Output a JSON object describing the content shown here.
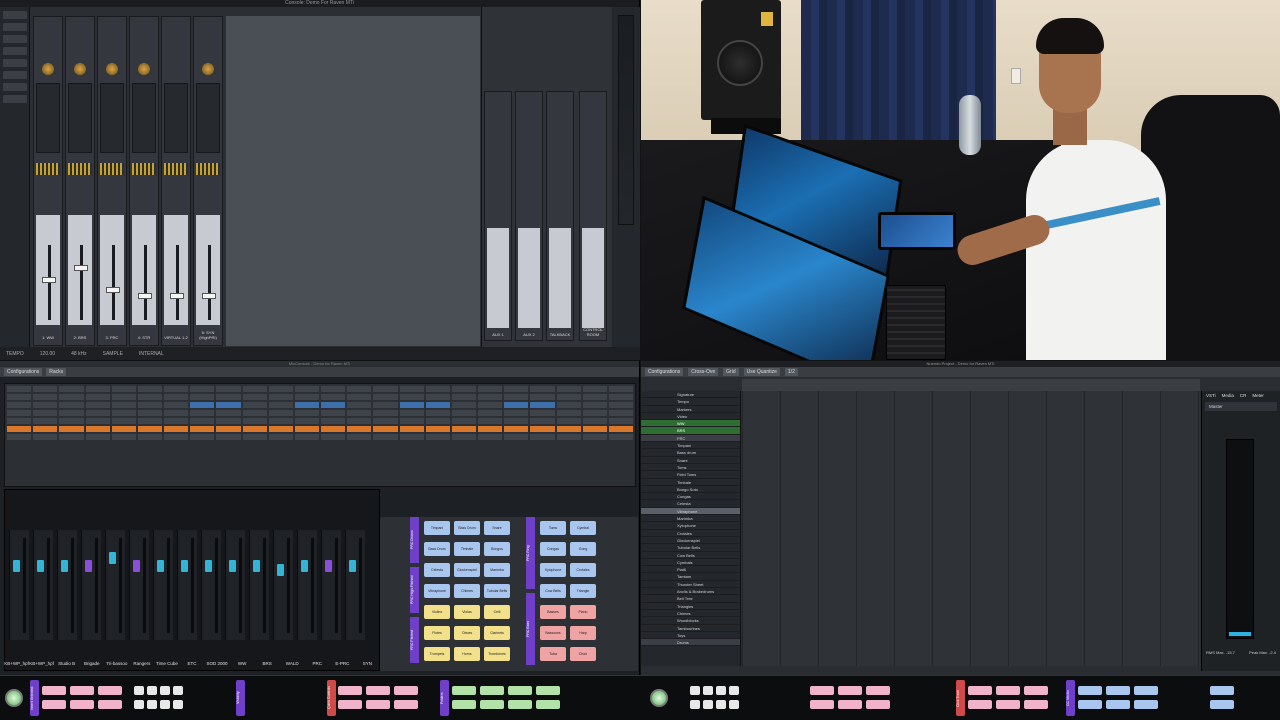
{
  "console": {
    "title": "Console: Demo For Raven MTi",
    "strip_labels": [
      "1: WW",
      "2: BRS",
      "3: PRC",
      "4: STR",
      "VIRTUAL 1-2",
      "5: SYN (HighPRI)"
    ],
    "aux_labels": [
      "AUX 1",
      "AUX 2",
      "TALKBACK",
      "CONTROL ROOM"
    ],
    "status": [
      "TEMPO",
      "120.00",
      "48 kHz",
      "SAMPLE",
      "INTERNAL"
    ]
  },
  "mixconsole": {
    "title": "MixConsole - Demo for Raven MTi",
    "toolbar": [
      "Configurations",
      "Racks"
    ],
    "fader_labels": [
      "KB+WP_hpf",
      "KB+WP_hpf",
      "Studio B",
      "Brigade",
      "Tri-bassoo",
      "Rangers",
      "Time Cube",
      "ETC",
      "SOD 2000",
      "WW",
      "BRS",
      "WALD",
      "PRC",
      "E-PRC",
      "SYN"
    ],
    "grid_columns": [
      "PRC Drums",
      "PRC High-Pitched",
      "PRC Pitched",
      "PRC Ring",
      "PRC Bass"
    ],
    "grid_pads": [
      [
        "Timpani",
        "Bass Drum",
        "Snare",
        "Toms",
        "Cymbal"
      ],
      [
        "Bass Drum",
        "Timbale",
        "Bongos",
        "Congas",
        "Gong"
      ],
      [
        "Celesta",
        "Glockenspiel",
        "Marimba",
        "Xylophone",
        "Crotales"
      ],
      [
        "Vibraphone",
        "Chimes",
        "Tubular Bells",
        "Cow Bells",
        "Triangle"
      ],
      [
        "Violins",
        "Violas",
        "Celli",
        "Basses",
        "Piano"
      ],
      [
        "Flutes",
        "Oboes",
        "Clarinets",
        "Bassoons",
        "Harp"
      ],
      [
        "Trumpets",
        "Horns",
        "Trombones",
        "Tuba",
        "Choir"
      ]
    ]
  },
  "project": {
    "title": "Nuendo Project - Demo for Raven MTi",
    "toolbar": [
      "Configurations",
      "Cross-Ove",
      "Grid",
      "Use Quantize",
      "1/2"
    ],
    "tracks": [
      {
        "name": "Signature",
        "kind": "normal"
      },
      {
        "name": "Tempo",
        "kind": "normal"
      },
      {
        "name": "Markers",
        "kind": "normal"
      },
      {
        "name": "Video",
        "kind": "normal"
      },
      {
        "name": "WW",
        "kind": "folder"
      },
      {
        "name": "BRS",
        "kind": "folder"
      },
      {
        "name": "PRC",
        "kind": "sel"
      },
      {
        "name": "Timpani",
        "kind": "normal"
      },
      {
        "name": "Bass drum",
        "kind": "normal"
      },
      {
        "name": "Snare",
        "kind": "normal"
      },
      {
        "name": "Toms",
        "kind": "normal"
      },
      {
        "name": "Field Toms",
        "kind": "normal"
      },
      {
        "name": "Timbale",
        "kind": "normal"
      },
      {
        "name": "Bongo Soto",
        "kind": "normal"
      },
      {
        "name": "Congas",
        "kind": "normal"
      },
      {
        "name": "Celesta",
        "kind": "normal"
      },
      {
        "name": "Vibraphone",
        "kind": "hl"
      },
      {
        "name": "Marimba",
        "kind": "normal"
      },
      {
        "name": "Xylophone",
        "kind": "normal"
      },
      {
        "name": "Crotales",
        "kind": "normal"
      },
      {
        "name": "Glockenspiel",
        "kind": "normal"
      },
      {
        "name": "Tubular Bells",
        "kind": "normal"
      },
      {
        "name": "Cow Bells",
        "kind": "normal"
      },
      {
        "name": "Cymbals",
        "kind": "normal"
      },
      {
        "name": "Piatti",
        "kind": "normal"
      },
      {
        "name": "Tamtam",
        "kind": "normal"
      },
      {
        "name": "Thunder Sheet",
        "kind": "normal"
      },
      {
        "name": "Anvils & Brakedrums",
        "kind": "normal"
      },
      {
        "name": "Bell Tree",
        "kind": "normal"
      },
      {
        "name": "Triangles",
        "kind": "normal"
      },
      {
        "name": "Chimes",
        "kind": "normal"
      },
      {
        "name": "Woodblocks",
        "kind": "normal"
      },
      {
        "name": "Tambourines",
        "kind": "normal"
      },
      {
        "name": "Toys",
        "kind": "normal"
      },
      {
        "name": "Drums",
        "kind": "sel"
      }
    ],
    "inspector_tabs": [
      "VSTi",
      "Media",
      "CR",
      "Meter"
    ],
    "inspector_title": "Master",
    "readouts": [
      "RMS Max. -15.7",
      "Peak Max. -2.4"
    ]
  },
  "ctrlbar": {
    "tabs": [
      "Insert Selected",
      "Visibility",
      "Quick Controls",
      "Folders",
      "Click Track",
      "CC Vector"
    ]
  },
  "colors": {
    "accent_purple": "#6f3fc9",
    "pad_blue": "#a9c6ef",
    "pad_red": "#f0a3a3",
    "pad_yellow": "#f3e08a",
    "pad_pink": "#f1b3c9",
    "pad_green": "#b2e2a8",
    "folder_green": "#2f6e32",
    "meter_blue": "#2fb0e0"
  }
}
